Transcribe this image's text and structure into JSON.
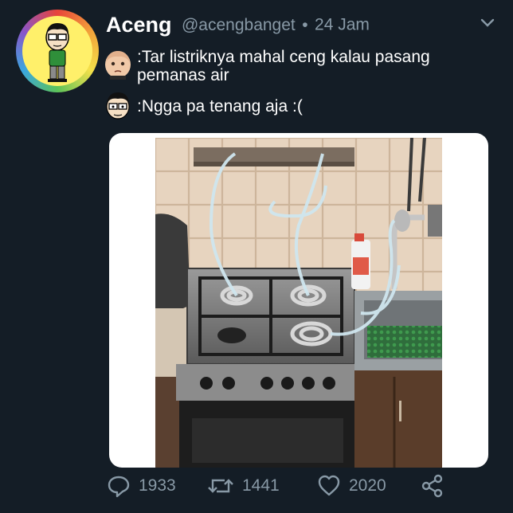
{
  "tweet": {
    "display_name": "Aceng",
    "handle": "@acengbanget",
    "separator": "•",
    "time": "24 Jam",
    "lines": [
      {
        "speaker_icon": "baby-face-icon",
        "text": ":Tar listriknya mahal ceng kalau pasang pemanas air"
      },
      {
        "speaker_icon": "aceng-face-icon",
        "text": ":Ngga pa tenang aja :("
      }
    ]
  },
  "actions": {
    "replies": "1933",
    "retweets": "1441",
    "likes": "2020"
  },
  "colors": {
    "background": "#141d26",
    "secondary_text": "#8899a6",
    "primary_text": "#ffffff"
  }
}
